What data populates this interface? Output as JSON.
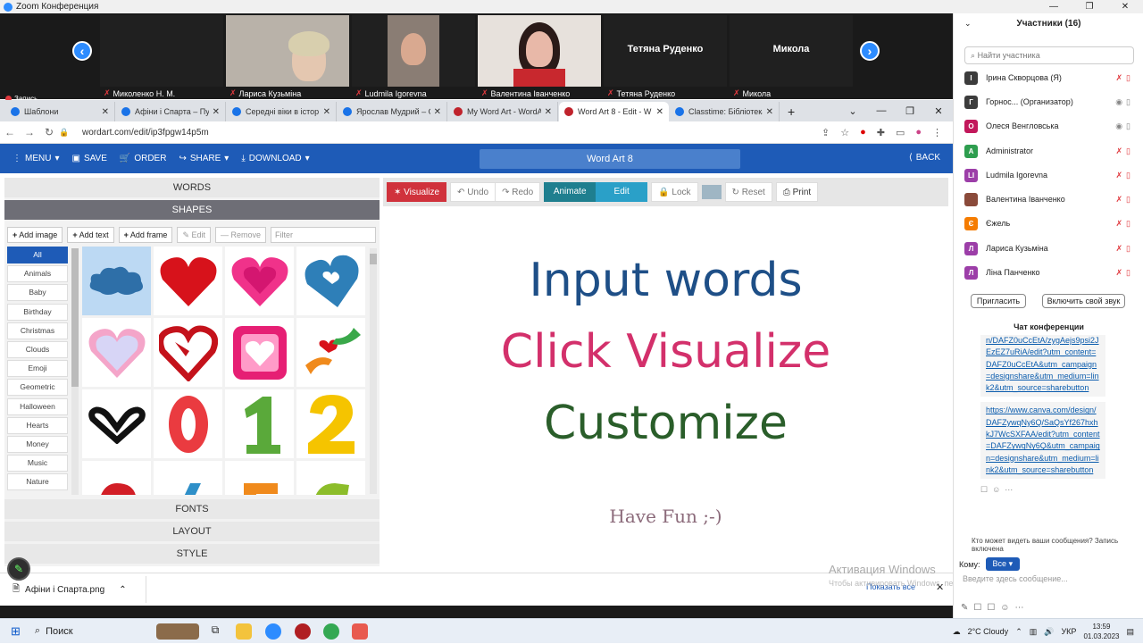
{
  "zoom": {
    "title": "Zoom Конференция",
    "record_label": "Запись",
    "video_tiles": [
      {
        "name": "Миколенко Н. М.",
        "big_name": ""
      },
      {
        "name": "Лариса Кузьміна",
        "big_name": ""
      },
      {
        "name": "Ludmila Igorevna",
        "big_name": ""
      },
      {
        "name": "Валентина Іванченко",
        "big_name": ""
      },
      {
        "name": "Тетяна Руденко",
        "big_name": "Тетяна Руденко"
      },
      {
        "name": "Микола",
        "big_name": "Микола"
      }
    ]
  },
  "browser": {
    "tabs": [
      {
        "title": "Шаблони",
        "color": "#1a73e8"
      },
      {
        "title": "Афіни і Спарта – Пу",
        "color": "#1a73e8"
      },
      {
        "title": "Середні віки в істор",
        "color": "#1a73e8"
      },
      {
        "title": "Ярослав Мудрий – G",
        "color": "#1a73e8"
      },
      {
        "title": "My Word Art - WordA",
        "color": "#c0232c"
      },
      {
        "title": "Word Art 8 - Edit - W",
        "color": "#c0232c"
      },
      {
        "title": "Classtime: Бібліотека",
        "color": "#1a73e8"
      }
    ],
    "url": "wordart.com/edit/ip3fpgw14p5m"
  },
  "wordart": {
    "menu": "MENU",
    "save": "SAVE",
    "order": "ORDER",
    "share": "SHARE",
    "download": "DOWNLOAD",
    "title": "Word Art 8",
    "back": "BACK",
    "sections": {
      "words": "WORDS",
      "shapes": "SHAPES",
      "fonts": "FONTS",
      "layout": "LAYOUT",
      "style": "STYLE"
    },
    "shape_tools": {
      "add_image": "Add image",
      "add_text": "Add text",
      "add_frame": "Add frame",
      "edit": "Edit",
      "remove": "Remove",
      "filter_placeholder": "Filter"
    },
    "categories": [
      "All",
      "Animals",
      "Baby",
      "Birthday",
      "Christmas",
      "Clouds",
      "Emoji",
      "Geometric",
      "Halloween",
      "Hearts",
      "Money",
      "Music",
      "Nature"
    ],
    "toolbar": {
      "visualize": "Visualize",
      "undo": "Undo",
      "redo": "Redo",
      "animate": "Animate",
      "edit": "Edit",
      "lock": "Lock",
      "reset": "Reset",
      "print": "Print"
    },
    "canvas_words": [
      "Input words",
      "Click Visualize",
      "Customize",
      "Have Fun ;-)"
    ]
  },
  "windows_activation": {
    "title": "Активация Windows",
    "subtitle": "Чтобы активировать Windows, перейдите в раздел \"Параметры\"."
  },
  "download_bar": {
    "file": "Афіни і Спарта.png",
    "show_all": "Показать все"
  },
  "participants": {
    "header": "Участники (16)",
    "search_placeholder": "Найти участника",
    "list": [
      {
        "initial": "І",
        "name": "Ірина Скворцова (Я)",
        "color": "#3c3c3c"
      },
      {
        "initial": "Г",
        "name": "Горнос... (Организатор)",
        "color": "#3c3c3c"
      },
      {
        "initial": "О",
        "name": "Олеся Венгловська",
        "color": "#c2185b"
      },
      {
        "initial": "A",
        "name": "Administrator",
        "color": "#2e9e4f"
      },
      {
        "initial": "LI",
        "name": "Ludmila Igorevna",
        "color": "#9c3ea8"
      },
      {
        "initial": "",
        "name": "Валентина Іванченко",
        "color": "#8a4a3a"
      },
      {
        "initial": "Є",
        "name": "Єжель",
        "color": "#f57c00"
      },
      {
        "initial": "Л",
        "name": "Лариса Кузьміна",
        "color": "#9c3ea8"
      },
      {
        "initial": "Л",
        "name": "Ліна Панченко",
        "color": "#9c3ea8"
      }
    ],
    "invite": "Пригласить",
    "unmute": "Включить свой звук"
  },
  "chat": {
    "header": "Чат конференции",
    "messages": [
      "n/DAFZ0uCcEtA/zygAejs9psi2JEzEZ7uRiA/edit?utm_content=DAFZ0uCcEtA&utm_campaign=designshare&utm_medium=link2&utm_source=sharebutton",
      "https://www.canva.com/design/DAFZywqNy6Q/SaQsYf267hxhkJ7WcSXFAA/edit?utm_content=DAFZywqNy6Q&utm_campaign=designshare&utm_medium=link2&utm_source=sharebutton"
    ],
    "who_can_see": "Кто может видеть ваши сообщения? Запись включена",
    "to_label": "Кому:",
    "to_value": "Все",
    "input_placeholder": "Введите здесь сообщение..."
  },
  "taskbar": {
    "search": "Поиск",
    "weather": "2°C Cloudy",
    "lang": "УКР",
    "time": "13:59",
    "date": "01.03.2023"
  }
}
